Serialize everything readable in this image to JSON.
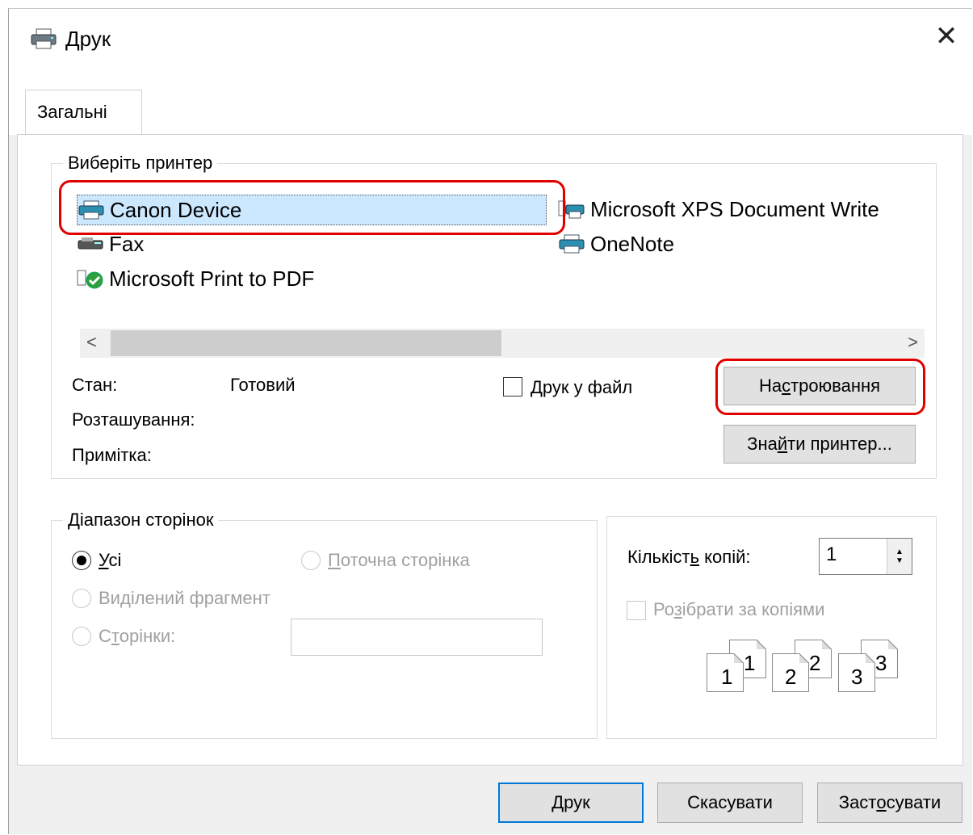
{
  "window": {
    "title": "Друк",
    "close_icon": "close-icon"
  },
  "tabs": [
    {
      "label": "Загальні"
    }
  ],
  "select_printer": {
    "legend": "Виберіть принтер",
    "printers": [
      {
        "name": "Canon Device",
        "icon": "printer-icon",
        "selected": true
      },
      {
        "name": "Microsoft XPS Document Write",
        "icon": "printer-icon"
      },
      {
        "name": "Fax",
        "icon": "fax-icon"
      },
      {
        "name": "OneNote",
        "icon": "printer-icon"
      },
      {
        "name": "Microsoft Print to PDF",
        "icon": "default-printer-icon"
      }
    ],
    "scroll_left": "<",
    "scroll_right": ">",
    "status_label": "Стан:",
    "status_value": "Готовий",
    "location_label": "Розташування:",
    "comment_label": "Примітка:",
    "print_to_file": {
      "pre": "",
      "mnemonic": "Д",
      "post": "рук у файл",
      "checked": false
    },
    "preferences": {
      "pre": "На",
      "mnemonic": "с",
      "post": "троювання"
    },
    "find_printer": {
      "pre": "Зна",
      "mnemonic": "й",
      "post": "ти принтер..."
    }
  },
  "page_range": {
    "legend": "Діапазон сторінок",
    "all": {
      "pre": "",
      "mnemonic": "У",
      "post": "сі",
      "checked": true
    },
    "selection": {
      "pre": "Ви",
      "mnemonic": "д",
      "post": "ілений фрагмент"
    },
    "current": {
      "pre": "",
      "mnemonic": "П",
      "post": "оточна сторінка"
    },
    "pages": {
      "pre": "С",
      "mnemonic": "т",
      "post": "орінки:",
      "value": ""
    }
  },
  "copies": {
    "count": {
      "pre": "Кількіст",
      "mnemonic": "ь",
      "post": " копій:"
    },
    "value": "1",
    "collate": {
      "pre": "Ро",
      "mnemonic": "з",
      "post": "ібрати за копіями",
      "checked": false
    },
    "collate_pages": [
      "1",
      "1",
      "2",
      "2",
      "3",
      "3"
    ]
  },
  "buttons": {
    "print": {
      "pre": "",
      "mnemonic": "Д",
      "post": "рук"
    },
    "cancel": "Скасувати",
    "apply": {
      "pre": "Заст",
      "mnemonic": "о",
      "post": "сувати"
    }
  },
  "highlight_color": "#e00000"
}
